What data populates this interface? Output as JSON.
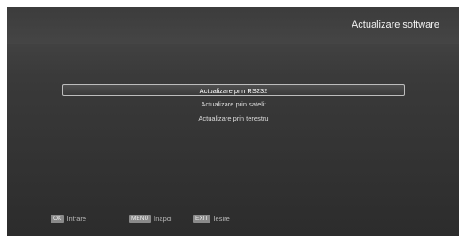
{
  "header": {
    "title": "Actualizare software"
  },
  "menu": {
    "items": [
      {
        "label": "Actualizare prin RS232",
        "selected": true
      },
      {
        "label": "Actualizare prin satelit",
        "selected": false
      },
      {
        "label": "Actualizare prin terestru",
        "selected": false
      }
    ]
  },
  "footer": {
    "hints": [
      {
        "key": "OK",
        "label": "Intrare"
      },
      {
        "key": "MENU",
        "label": "Inapoi"
      },
      {
        "key": "EXIT",
        "label": "Iesire"
      }
    ]
  }
}
